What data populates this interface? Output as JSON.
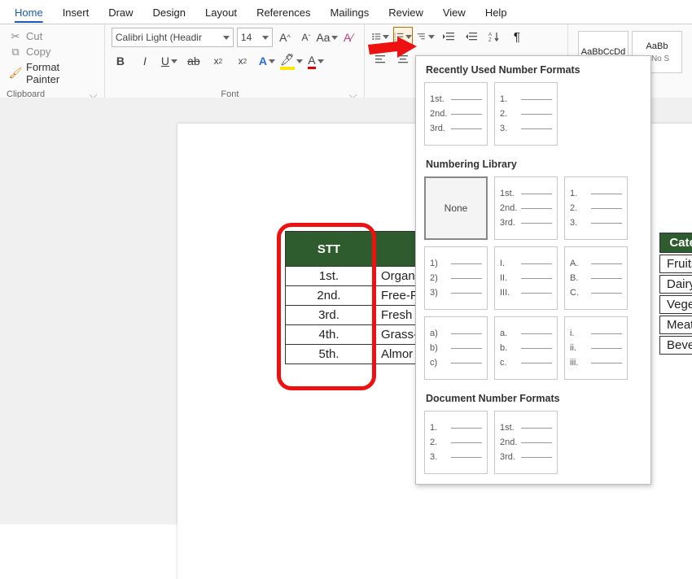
{
  "menu": {
    "tabs": [
      "Home",
      "Insert",
      "Draw",
      "Design",
      "Layout",
      "References",
      "Mailings",
      "Review",
      "View",
      "Help"
    ],
    "active": "Home"
  },
  "clipboard": {
    "cut": "Cut",
    "copy": "Copy",
    "format_painter": "Format Painter",
    "label": "Clipboard"
  },
  "font": {
    "name": "Calibri Light (Headir",
    "size": "14",
    "label": "Font"
  },
  "styles": {
    "a": "AaBbCcDd",
    "b": "AaBb",
    "nospace": "¶ No S"
  },
  "table": {
    "header": "STT",
    "rows": [
      {
        "n": "1st.",
        "p": "Organ"
      },
      {
        "n": "2nd.",
        "p": "Free-F"
      },
      {
        "n": "3rd.",
        "p": "Fresh"
      },
      {
        "n": "4th.",
        "p": "Grass-"
      },
      {
        "n": "5th.",
        "p": "Almor"
      }
    ]
  },
  "sideTable": {
    "header": "Cate",
    "rows": [
      "Fruits",
      "Dairy",
      "Veget",
      "Meat",
      "Bever"
    ]
  },
  "numpanel": {
    "section1": "Recently Used Number Formats",
    "section2": "Numbering Library",
    "section3": "Document Number Formats",
    "none": "None",
    "fmt_ordinal": [
      "1st.",
      "2nd.",
      "3rd."
    ],
    "fmt_decimal": [
      "1.",
      "2.",
      "3."
    ],
    "fmt_paren": [
      "1)",
      "2)",
      "3)"
    ],
    "fmt_roman": [
      "I.",
      "II.",
      "III."
    ],
    "fmt_alpha": [
      "A.",
      "B.",
      "C."
    ],
    "fmt_lparen": [
      "a)",
      "b)",
      "c)"
    ],
    "fmt_lalpha": [
      "a.",
      "b.",
      "c."
    ],
    "fmt_lroman": [
      "i.",
      "ii.",
      "iii."
    ]
  }
}
